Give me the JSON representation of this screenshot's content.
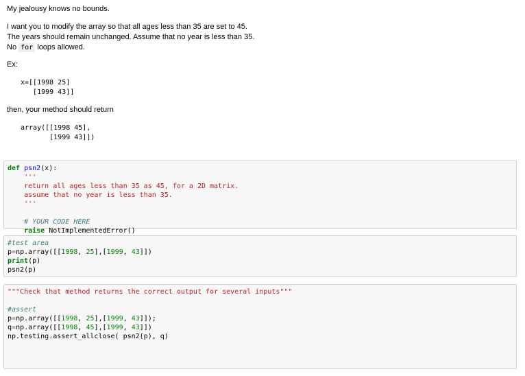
{
  "markdown": {
    "title": "My jealousy knows no bounds.",
    "para1_line1": "I want you to modify the array so that all ages less than 35 are set to 45.",
    "para1_line2": "The years should remain unchanged. Assume that no year is less than 35.",
    "para1_line3_pre": "No ",
    "para1_line3_code": "for",
    "para1_line3_post": " loops allowed.",
    "ex_label": "Ex:",
    "example_input": "x=[[1998 25]\n   [1999 43]]",
    "then_text": "then, your method should return",
    "example_output": "array([[1998 45],\n       [1999 43]])"
  },
  "cells": {
    "cell1": {
      "def_kw": "def",
      "fn_name": "psn2",
      "sig_rest": "(x):",
      "docstring": "    '''\n    return all ages less than 35 as 45, for a 2D matrix.\n    assume that no year is less than 35.\n    '''",
      "comment": "    # YOUR CODE HERE",
      "raise_kw": "    raise",
      "raise_rest": " NotImplementedError()"
    },
    "cell2": {
      "comment": "#test area",
      "l1_a": "p",
      "l1_b": "=",
      "l1_c": "np.array([[",
      "l1_n1": "1998",
      "l1_d": ", ",
      "l1_n2": "25",
      "l1_e": "],[",
      "l1_n3": "1999",
      "l1_f": ", ",
      "l1_n4": "43",
      "l1_g": "]])",
      "l2_kw": "print",
      "l2_rest": "(p)",
      "l3": "psn2(p)"
    },
    "cell3": {
      "docstring": "\"\"\"Check that method returns the correct output for several inputs\"\"\"",
      "comment": "#assert",
      "l1_a": "p",
      "l1_b": "=",
      "l1_c": "np.array([[",
      "l1_n1": "1998",
      "l1_d": ", ",
      "l1_n2": "25",
      "l1_e": "],[",
      "l1_n3": "1999",
      "l1_f": ", ",
      "l1_n4": "43",
      "l1_g": "]]);",
      "l2_a": "q",
      "l2_b": "=",
      "l2_c": "np.array([[",
      "l2_n1": "1998",
      "l2_d": ", ",
      "l2_n2": "45",
      "l2_e": "],[",
      "l2_n3": "1999",
      "l2_f": ", ",
      "l2_n4": "43",
      "l2_g": "]])",
      "l3": "np.testing.assert_allclose( psn2(p), q)"
    }
  }
}
